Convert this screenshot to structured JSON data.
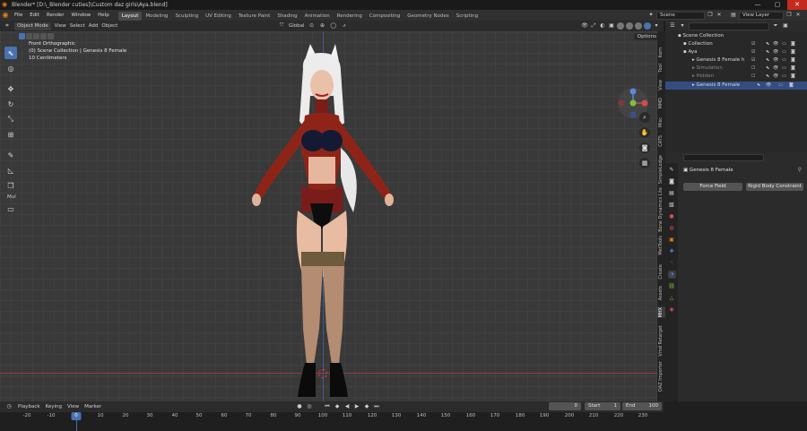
{
  "window": {
    "title": "Blender* [D:\\_Blender cuties]\\Custom daz girls\\Aya.blend]",
    "controls": [
      "—",
      "▢",
      "✕"
    ]
  },
  "menubar": {
    "menus": [
      "File",
      "Edit",
      "Render",
      "Window",
      "Help"
    ],
    "workspaces": [
      "Layout",
      "Modeling",
      "Sculpting",
      "UV Editing",
      "Texture Paint",
      "Shading",
      "Animation",
      "Rendering",
      "Compositing",
      "Geometry Nodes",
      "Scripting"
    ],
    "active_workspace": "Layout",
    "scene": "Scene",
    "view_layer": "View Layer"
  },
  "viewport_header": {
    "mode": "Object Mode",
    "menus": [
      "View",
      "Select",
      "Add",
      "Object"
    ],
    "orientation": "Global",
    "options_label": "Options"
  },
  "viewport": {
    "view_name": "Front Orthographic",
    "collection_info": "(0) Scene Collection | Genesis 8 Female",
    "scale": "10 Centimeters",
    "tool_panel_label": "Mul"
  },
  "n_panel_tabs": [
    "Item",
    "Tool",
    "View",
    "MMD",
    "Misc",
    "CATS",
    "SimpleLodge",
    "Bone Dynamics Lite",
    "MetTools",
    "Create",
    "Assets",
    "MHX",
    "Vmd Retarget",
    "DAZ Importer"
  ],
  "outliner": {
    "rows": [
      {
        "label": "Scene Collection",
        "indent": 0,
        "state": "normal"
      },
      {
        "label": "Collection",
        "indent": 1,
        "state": "normal"
      },
      {
        "label": "Aya",
        "indent": 1,
        "state": "normal"
      },
      {
        "label": "Genesis 8 Female h",
        "indent": 2,
        "state": "normal"
      },
      {
        "label": "Simulation",
        "indent": 2,
        "state": "dim"
      },
      {
        "label": "Hidden",
        "indent": 2,
        "state": "dim"
      },
      {
        "label": "Genesis 8 Female",
        "indent": 2,
        "state": "selected"
      }
    ]
  },
  "properties": {
    "object_name": "Genesis 8 Female",
    "buttons": [
      "Force Field",
      "Rigid Body Constraint"
    ]
  },
  "timeline": {
    "menus": [
      "Playback",
      "Keying",
      "View",
      "Marker"
    ],
    "current_frame": "0",
    "start_label": "Start",
    "start": "1",
    "end_label": "End",
    "end": "100",
    "ticks": [
      "-20",
      "-10",
      "0",
      "10",
      "20",
      "30",
      "40",
      "50",
      "60",
      "70",
      "80",
      "90",
      "100",
      "110",
      "120",
      "130",
      "140",
      "150",
      "160",
      "170",
      "180",
      "190",
      "200",
      "210",
      "220",
      "230",
      "240"
    ]
  },
  "colors": {
    "accent": "#4772b3",
    "blender_orange": "#e87d0d",
    "close_red": "#c42b1c"
  }
}
